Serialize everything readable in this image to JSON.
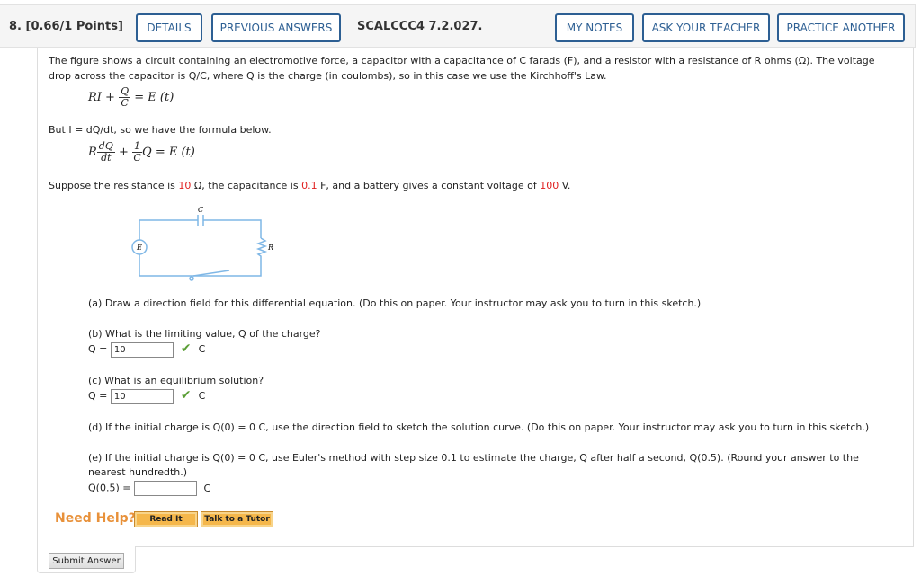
{
  "header": {
    "question": "8.  [0.66/1 Points]",
    "details": "DETAILS",
    "previous_answers": "PREVIOUS ANSWERS",
    "code": "SCALCCC4 7.2.027.",
    "my_notes": "MY NOTES",
    "ask_teacher": "ASK YOUR TEACHER",
    "practice": "PRACTICE ANOTHER"
  },
  "problem": {
    "intro1": "The figure shows a circuit containing an electromotive force, a capacitor with a capacitance of C farads (F), and a resistor with a resistance of R ohms (Ω). The voltage",
    "intro2": "drop across the capacitor is Q/C, where Q is the charge (in coulombs), so in this case we use the Kirchhoff's Law.",
    "eq1": {
      "left": "RI +",
      "num": "Q",
      "den": "C",
      "right": "= E (t)"
    },
    "but": "But I = dQ/dt, so we have the formula below.",
    "eq2": {
      "r": "R",
      "num1": "dQ",
      "den1": "dt",
      "plus": "+",
      "num2": "1",
      "den2": "C",
      "right": "Q = E (t)"
    },
    "suppose": {
      "a": "Suppose the resistance is ",
      "r": "10",
      "b": " Ω, the capacitance is ",
      "c": "0.1",
      "d": " F, and a battery gives a constant voltage of ",
      "v": "100",
      "e": " V."
    },
    "figure": {
      "c": "C",
      "e": "E",
      "r": "R"
    },
    "a": "(a) Draw a direction field for this differential equation. (Do this on paper. Your instructor may ask you to turn in this sketch.)",
    "b": {
      "q": "(b) What is the limiting value, Q of the charge?",
      "label": "Q =",
      "value": "10",
      "unit": "C"
    },
    "c": {
      "q": "(c) What is an equilibrium solution?",
      "label": "Q =",
      "value": "10",
      "unit": "C"
    },
    "d": "(d) If the initial charge is Q(0) = 0 C, use the direction field to sketch the solution curve. (Do this on paper. Your instructor may ask you to turn in this sketch.)",
    "e": {
      "q1": "(e) If the initial charge is Q(0) = 0 C, use Euler's method with step size 0.1 to estimate the charge, Q after half a second, Q(0.5). (Round your answer to the",
      "q2": "nearest hundredth.)",
      "label": "Q(0.5) =",
      "value": "",
      "unit": "C"
    }
  },
  "help": {
    "label": "Need Help?",
    "read": "Read It",
    "tutor": "Talk to a Tutor"
  },
  "submit": "Submit Answer",
  "colors": {
    "accent": "#2d5f93",
    "highlight": "#e02020",
    "help": "#e8913a",
    "check": "#5a9e35"
  }
}
